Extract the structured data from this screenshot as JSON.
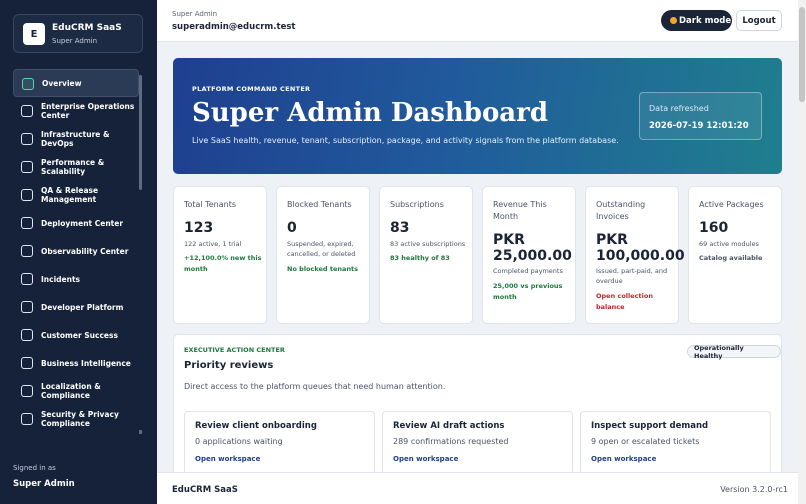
{
  "sidebar": {
    "brand_logo": "E",
    "brand_name": "EduCRM SaaS",
    "brand_sub": "Super Admin",
    "items": [
      {
        "label": "Overview",
        "icon": "overview-icon"
      },
      {
        "label": "Enterprise Operations Center",
        "icon": "operations-icon"
      },
      {
        "label": "Infrastructure & DevOps",
        "icon": "server-icon"
      },
      {
        "label": "Performance & Scalability",
        "icon": "performance-icon"
      },
      {
        "label": "QA & Release Management",
        "icon": "qa-icon"
      },
      {
        "label": "Deployment Center",
        "icon": "deploy-icon"
      },
      {
        "label": "Observability Center",
        "icon": "observability-icon"
      },
      {
        "label": "Incidents",
        "icon": "incident-icon"
      },
      {
        "label": "Developer Platform",
        "icon": "code-icon"
      },
      {
        "label": "Customer Success",
        "icon": "support-icon"
      },
      {
        "label": "Business Intelligence",
        "icon": "chart-icon"
      },
      {
        "label": "Localization & Compliance",
        "icon": "globe-icon"
      },
      {
        "label": "Security & Privacy Compliance",
        "icon": "shield-icon"
      }
    ],
    "signed_label": "Signed in as",
    "signed_user": "Super Admin"
  },
  "topbar": {
    "role": "Super Admin",
    "email": "superadmin@educrm.test",
    "dark_mode_label": "Dark mode",
    "logout_label": "Logout"
  },
  "hero": {
    "kicker": "PLATFORM COMMAND CENTER",
    "title": "Super Admin Dashboard",
    "description": "Live SaaS health, revenue, tenant, subscription, package, and activity signals from the platform database.",
    "refresh_label": "Data refreshed",
    "refresh_value": "2026-07-19 12:01:20"
  },
  "cards": [
    {
      "label": "Total Tenants",
      "value": "123",
      "sub": "122 active, 1 trial",
      "trend": "+12,100.0% new this month"
    },
    {
      "label": "Blocked Tenants",
      "value": "0",
      "sub": "Suspended, expired, cancelled, or deleted",
      "trend": "No blocked tenants"
    },
    {
      "label": "Subscriptions",
      "value": "83",
      "sub": "83 active subscriptions",
      "trend": "83 healthy of 83"
    },
    {
      "label": "Revenue This Month",
      "value": "PKR 25,000.00",
      "sub": "Completed payments",
      "trend": "25,000 vs previous month"
    },
    {
      "label": "Outstanding Invoices",
      "value": "PKR 100,000.00",
      "sub": "Issued, part-paid, and overdue",
      "trend": "Open collection balance"
    },
    {
      "label": "Active Packages",
      "value": "160",
      "sub": "69 active modules",
      "trend": "Catalog available"
    }
  ],
  "actions": {
    "kicker": "EXECUTIVE ACTION CENTER",
    "title": "Priority reviews",
    "description": "Direct access to the platform queues that need human attention.",
    "badge": "Operationally Healthy",
    "queues": [
      {
        "title": "Review client onboarding",
        "desc": "0 applications waiting",
        "link": "Open workspace"
      },
      {
        "title": "Review AI draft actions",
        "desc": "289 confirmations requested",
        "link": "Open workspace"
      },
      {
        "title": "Inspect support demand",
        "desc": "9 open or escalated tickets",
        "link": "Open workspace"
      }
    ]
  },
  "footer": {
    "left": "EduCRM SaaS",
    "right": "Version 3.2.0-rc1"
  },
  "colors": {
    "sidebar_bg": "#16223a",
    "hero_start": "#1f3f8f",
    "hero_end": "#1f7f8e",
    "positive": "#1b7a3b",
    "negative": "#c0262d",
    "dark_mode_dot": "#f4a52a"
  }
}
